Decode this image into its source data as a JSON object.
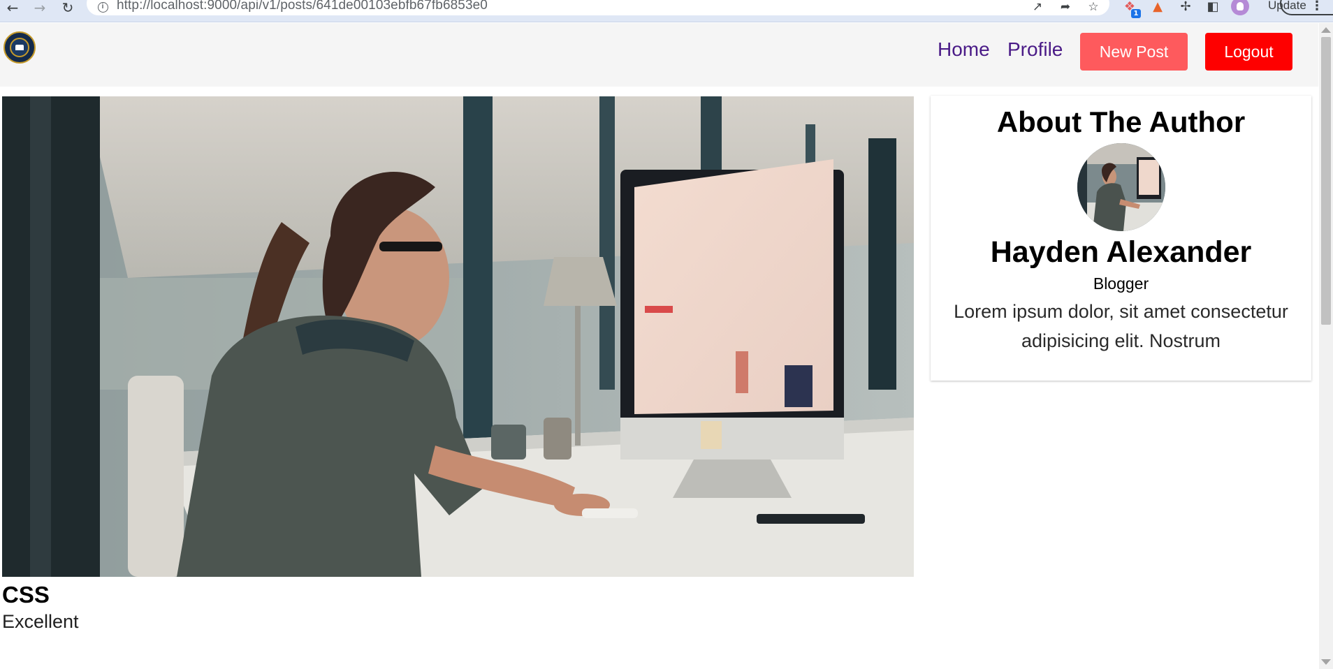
{
  "browser": {
    "back_icon": "arrow-left-icon",
    "forward_icon": "arrow-right-icon",
    "reload_icon": "reload-icon",
    "url": "http://localhost:9000/api/v1/posts/641de00103ebfb67fb6853e0",
    "update_label": "Update",
    "extension_badge": "1"
  },
  "navbar": {
    "home_label": "Home",
    "profile_label": "Profile",
    "new_post_label": "New Post",
    "logout_label": "Logout",
    "link_color": "#4a1b87",
    "new_post_color": "#fe5a5d",
    "logout_color": "#fe0000"
  },
  "post": {
    "title": "CSS",
    "rating": "Excellent"
  },
  "author": {
    "heading": "About The Author",
    "name": "Hayden Alexander",
    "role": "Blogger",
    "bio": "Lorem ipsum dolor, sit amet consectetur adipisicing elit. Nostrum"
  }
}
